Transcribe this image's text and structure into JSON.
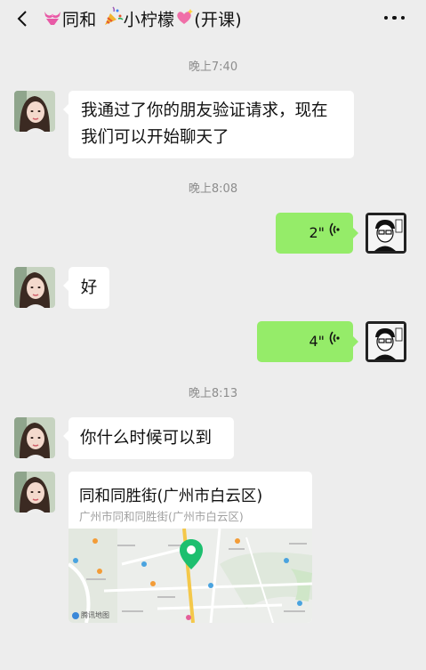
{
  "header": {
    "title_name1": "同和",
    "title_name2": "小柠檬",
    "title_suffix": "(开课)",
    "icons": [
      "back-arrow-icon",
      "bikini-icon",
      "party-popper-icon",
      "sparkling-heart-icon",
      "more-dots-icon"
    ]
  },
  "messages": {
    "time1": "晚上7:40",
    "msg1": "我通过了你的朋友验证请求，现在我们可以开始聊天了",
    "time2": "晚上8:08",
    "voice1": "2\"",
    "msg2": "好",
    "voice2": "4\"",
    "time3": "晚上8:13",
    "msg3": "你什么时候可以到",
    "location": {
      "name": "同和同胜街(广州市白云区)",
      "address": "广州市同和同胜街(广州市白云区)",
      "map_watermark": "腾讯地图"
    }
  },
  "colors": {
    "background": "#ededed",
    "bubble_self": "#95ec69",
    "bubble_other": "#ffffff",
    "map_pin": "#1dbf6f"
  }
}
